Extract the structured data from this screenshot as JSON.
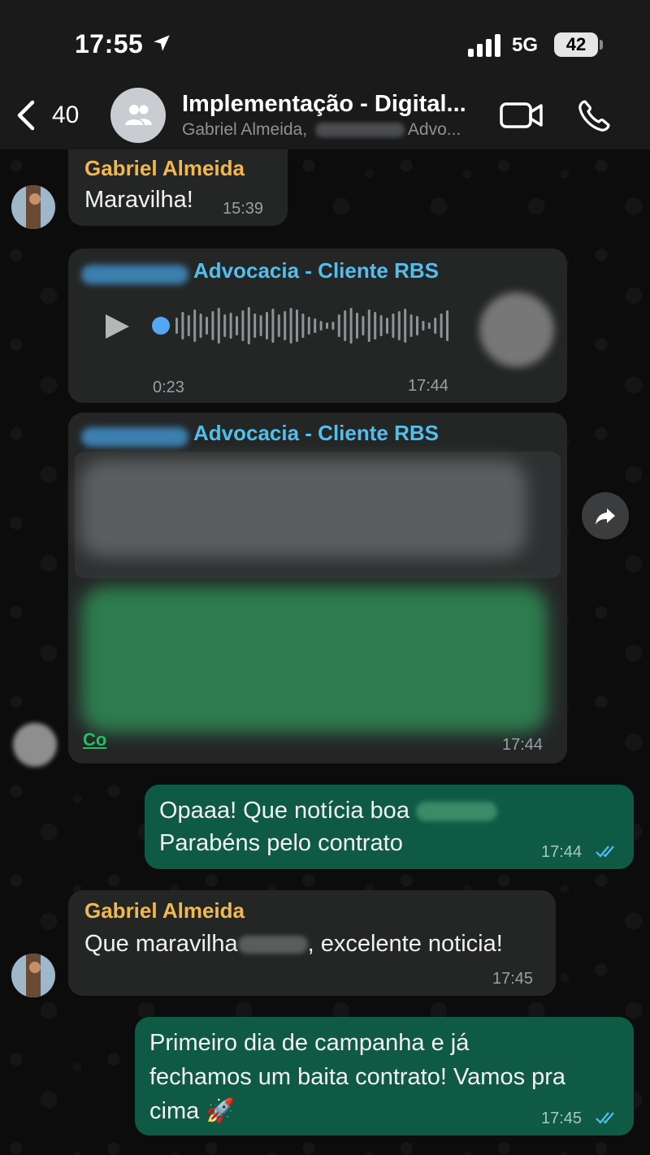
{
  "status_bar": {
    "time": "17:55",
    "network": "5G",
    "battery": "42"
  },
  "header": {
    "back_count": "40",
    "title": "Implementação - Digital...",
    "subtitle_start": "Gabriel Almeida, ",
    "subtitle_end": "Advo..."
  },
  "messages": [
    {
      "sender": "Gabriel Almeida",
      "text": "Maravilha!",
      "time": "15:39"
    },
    {
      "sender": "Advocacia - Cliente RBS",
      "type": "voice",
      "duration": "0:23",
      "time": "17:44"
    },
    {
      "sender": "Advocacia - Cliente RBS",
      "type": "forwarded",
      "time": "17:44",
      "link_prefix": "Co"
    },
    {
      "line1": "Opaaa! Que notícia boa",
      "line2": "Parabéns pelo contrato",
      "time": "17:44"
    },
    {
      "sender": "Gabriel Almeida",
      "text_start": "Que maravilha",
      "text_end": ", excelente noticia!",
      "time": "17:45"
    },
    {
      "line1": "Primeiro dia de campanha e já",
      "line2": "fechamos um baita contrato! Vamos pra",
      "line3": "cima 🚀",
      "time": "17:45"
    }
  ],
  "colors": {
    "incoming_bubble": "#242626",
    "outgoing_bubble": "#0f5a45",
    "sender_name": "#f0b84e",
    "quoted_name": "#53bdeb",
    "read_ticks": "#53bdeb"
  },
  "icons": [
    "location-arrow-icon",
    "signal-bars-icon",
    "back-chevron-icon",
    "group-icon",
    "video-camera-icon",
    "phone-icon",
    "play-icon",
    "forward-icon",
    "double-check-icon"
  ]
}
